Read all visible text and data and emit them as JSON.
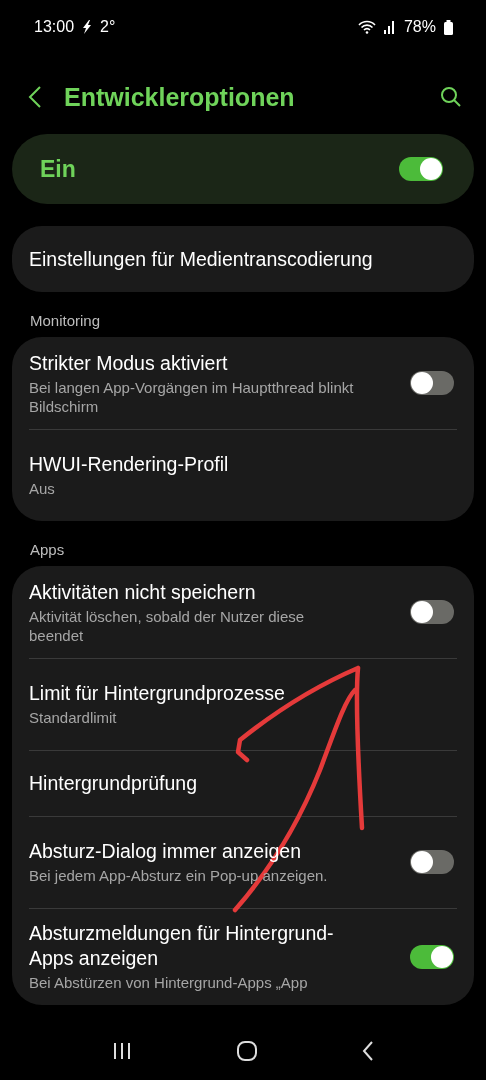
{
  "status_bar": {
    "time": "13:00",
    "temperature": "2°",
    "battery": "78%"
  },
  "header": {
    "title": "Entwickleroptionen"
  },
  "master_switch": {
    "label": "Ein",
    "on": true
  },
  "sections": [
    {
      "items": [
        {
          "kind": "plain",
          "title": "Einstellungen für Medientranscodierung"
        }
      ]
    },
    {
      "header": "Monitoring",
      "items": [
        {
          "kind": "toggle",
          "title": "Strikter Modus aktiviert",
          "summary": "Bei langen App-Vorgängen im Hauptthread blinkt Bildschirm",
          "on": false
        },
        {
          "kind": "plain",
          "title": "HWUI-Rendering-Profil",
          "summary": "Aus"
        }
      ]
    },
    {
      "header": "Apps",
      "items": [
        {
          "kind": "toggle",
          "title": "Aktivitäten nicht speichern",
          "summary": "Aktivität löschen, sobald der Nutzer diese beendet",
          "on": false
        },
        {
          "kind": "plain",
          "title": "Limit für Hintergrundprozesse",
          "summary": "Standardlimit"
        },
        {
          "kind": "plain",
          "title": "Hintergrundprüfung"
        },
        {
          "kind": "toggle",
          "title": "Absturz-Dialog immer anzeigen",
          "summary": "Bei jedem App-Absturz ein Pop-up anzeigen.",
          "on": false
        },
        {
          "kind": "toggle",
          "title": "Absturzmeldungen für Hintergrund-Apps anzeigen",
          "summary": "Bei Abstürzen von Hintergrund-Apps „App",
          "on": true
        }
      ]
    }
  ]
}
